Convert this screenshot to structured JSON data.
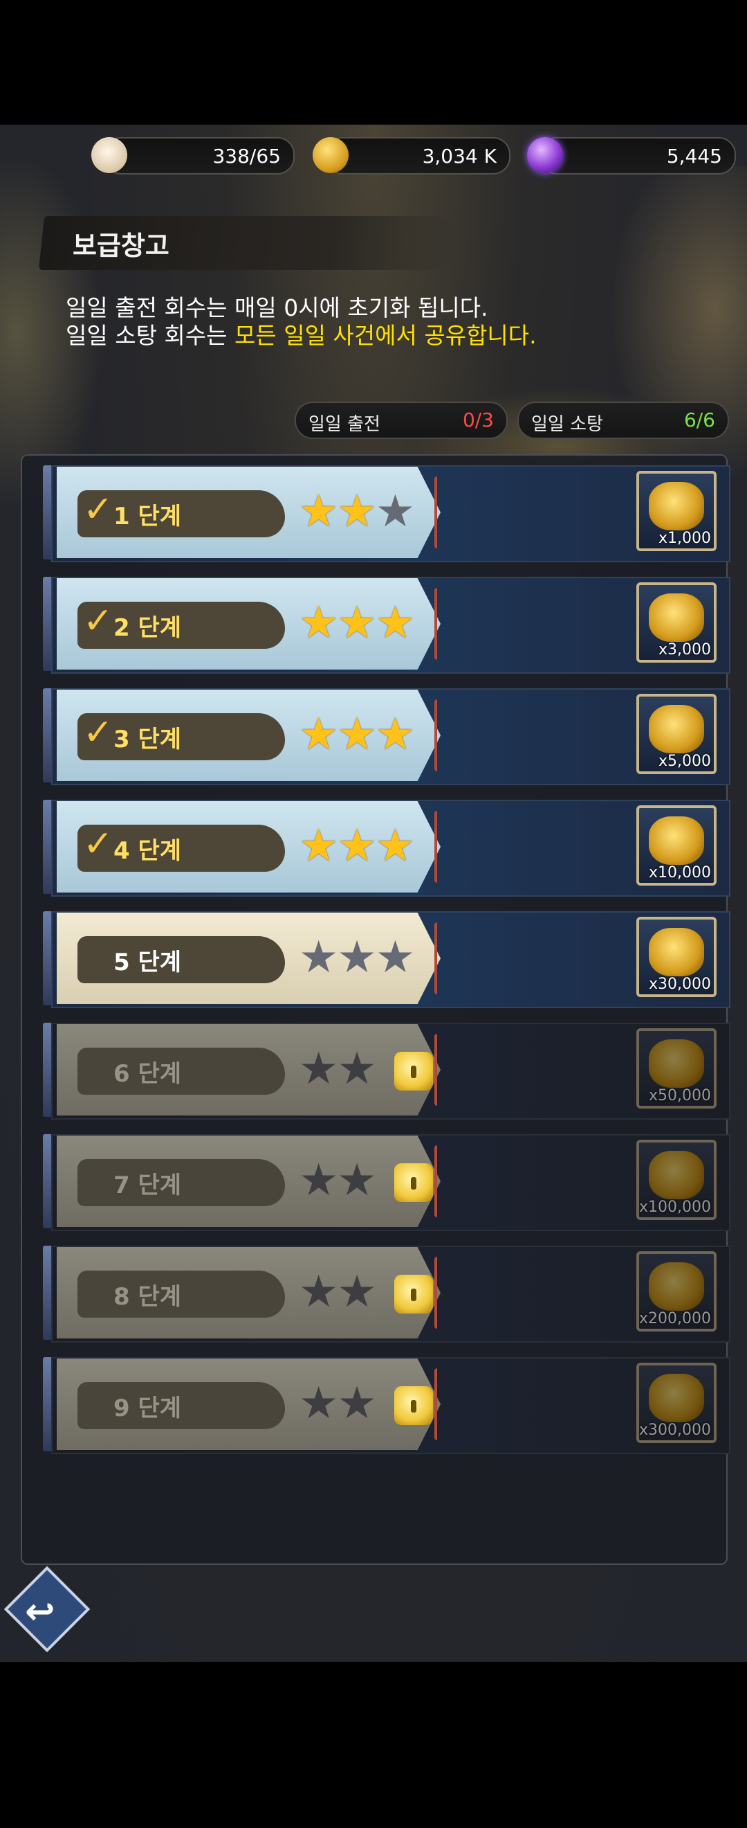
{
  "currency": {
    "stamina": "338/65",
    "gold": "3,034 K",
    "gems": "5,445"
  },
  "header": {
    "title": "보급창고",
    "desc_line1": "일일 출전 회수는 매일 0시에 초기화 됩니다.",
    "desc_line2_prefix": "일일 소탕 회수는 ",
    "desc_line2_highlight": "모든 일일 사건에서 공유합니다."
  },
  "counters": {
    "sortie_label": "일일 출전",
    "sortie_value": "0/3",
    "sweep_label": "일일 소탕",
    "sweep_value": "6/6"
  },
  "stages": [
    {
      "label": "1 단계",
      "stars": 2,
      "reward": "x1,000",
      "state": "done"
    },
    {
      "label": "2 단계",
      "stars": 3,
      "reward": "x3,000",
      "state": "done"
    },
    {
      "label": "3 단계",
      "stars": 3,
      "reward": "x5,000",
      "state": "done"
    },
    {
      "label": "4 단계",
      "stars": 3,
      "reward": "x10,000",
      "state": "done"
    },
    {
      "label": "5 단계",
      "stars": 0,
      "reward": "x30,000",
      "state": "open"
    },
    {
      "label": "6 단계",
      "stars": 0,
      "reward": "x50,000",
      "state": "locked"
    },
    {
      "label": "7 단계",
      "stars": 0,
      "reward": "x100,000",
      "state": "locked"
    },
    {
      "label": "8 단계",
      "stars": 0,
      "reward": "x200,000",
      "state": "locked"
    },
    {
      "label": "9 단계",
      "stars": 0,
      "reward": "x300,000",
      "state": "locked"
    }
  ],
  "icons": {
    "check": "checkmark-icon",
    "star": "star-icon",
    "lock": "lock-icon",
    "reward": "gold-coins-icon",
    "back": "back-arrow-icon"
  },
  "colors": {
    "highlight": "#ffe100",
    "sortie_value": "#ff4a4a",
    "sweep_value": "#7be04a",
    "star": "#ffc21a"
  }
}
